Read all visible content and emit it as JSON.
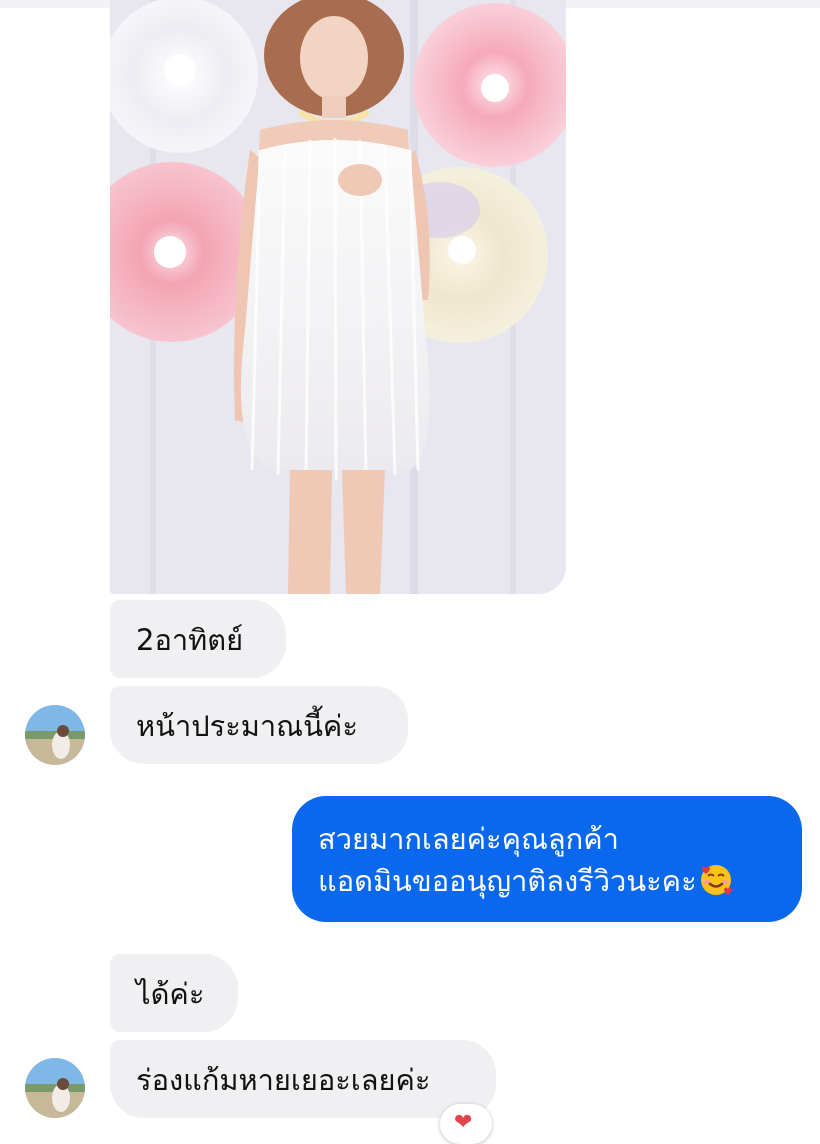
{
  "messages": {
    "m1": "2อาทิตย์",
    "m2": "หน้าประมาณนี้ค่ะ",
    "m3_line1": "สวยมากเลยค่ะคุณลูกค้า",
    "m3_line2": "แอดมินขออนุญาติลงรีวิวนะคะ",
    "m4": "ได้ค่ะ",
    "m5": "ร่องแก้มหายเยอะเลยค่ะ"
  },
  "reaction": {
    "icon": "heart-icon",
    "glyph": "❤"
  },
  "emoji": {
    "icon": "smiling-face-with-hearts-icon"
  },
  "colors": {
    "outgoing_bubble": "#0a68ee",
    "incoming_bubble": "#f0f0f2",
    "reaction_heart": "#e0454e"
  }
}
